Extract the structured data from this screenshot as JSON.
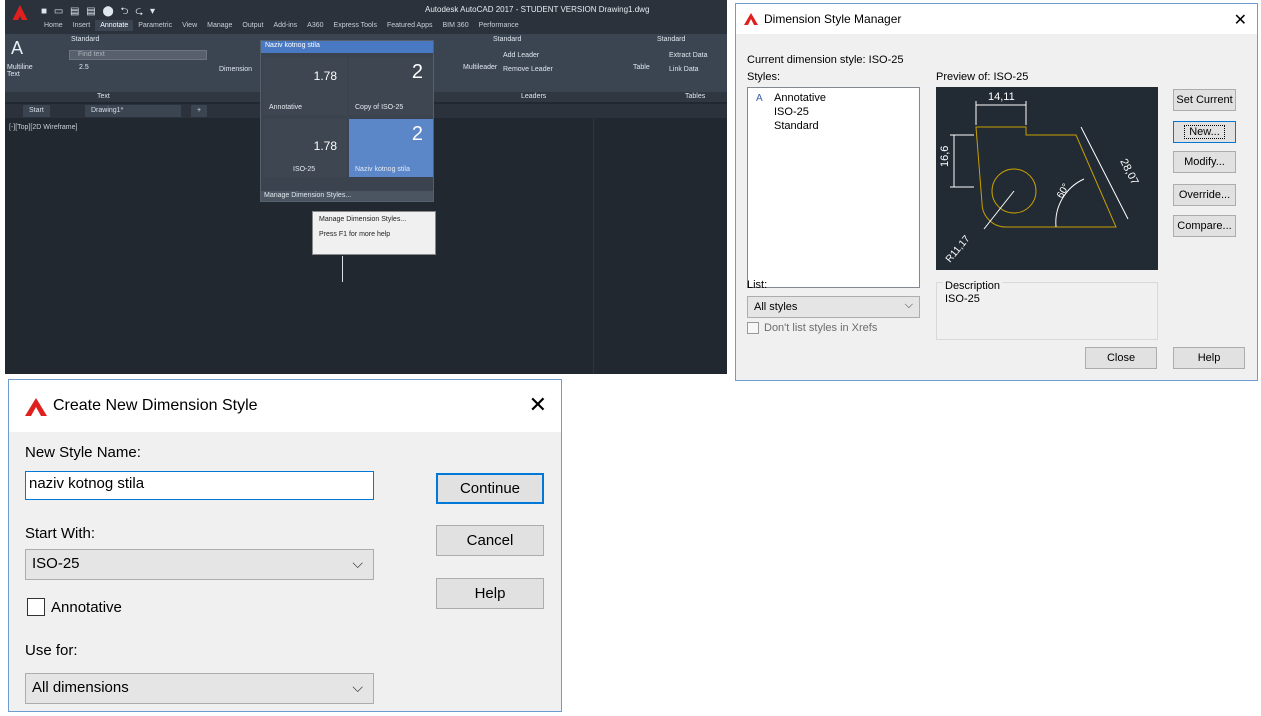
{
  "acad": {
    "title": "Autodesk AutoCAD 2017 - STUDENT VERSION   Drawing1.dwg",
    "ribbon_tabs": [
      "Home",
      "Insert",
      "Annotate",
      "Parametric",
      "View",
      "Manage",
      "Output",
      "Add-ins",
      "A360",
      "Express Tools",
      "Featured Apps",
      "BIM 360",
      "Performance"
    ],
    "active_tab": "Annotate",
    "text_panel": {
      "multiline_text": "Multiline Text",
      "style": "Standard",
      "find": "Find text",
      "height": "2.5",
      "panel_label": "Text"
    },
    "dimension_label": "Dimension",
    "gallery": {
      "header": "Naziv kotnog stila",
      "cells": [
        {
          "value": "1.78",
          "caption": "Annotative",
          "big": "2"
        },
        {
          "caption": "Copy of ISO-25"
        },
        {
          "value": "1.78",
          "caption": "ISO-25",
          "big": "2"
        },
        {
          "caption": "Naziv kotnog stila"
        }
      ],
      "footer": "Manage Dimension Styles..."
    },
    "context_menu": {
      "item1": "Manage Dimension Styles...",
      "item2": "Press F1 for more help"
    },
    "leaders_panel": {
      "multileader": "Multileader",
      "style": "Standard",
      "add_leader": "Add Leader",
      "remove_leader": "Remove Leader",
      "panel_label": "Leaders"
    },
    "tables_panel": {
      "table": "Table",
      "style": "Standard",
      "extract": "Extract Data",
      "link": "Link Data",
      "panel_label": "Tables"
    },
    "doc_tabs": {
      "start": "Start",
      "drawing": "Drawing1*"
    },
    "viewport_label": "[-][Top][2D Wireframe]"
  },
  "dsm": {
    "title": "Dimension Style Manager",
    "current_style": "Current dimension style: ISO-25",
    "styles_label": "Styles:",
    "styles": [
      "Annotative",
      "ISO-25",
      "Standard"
    ],
    "preview_label": "Preview of: ISO-25",
    "preview": {
      "dim1": "14,11",
      "dim2": "16,6",
      "dim3": "28,07",
      "angle": "60°",
      "radius": "R11,17"
    },
    "list_label": "List:",
    "list_value": "All styles",
    "dont_list": "Don't list styles in Xrefs",
    "description_label": "Description",
    "description_value": "ISO-25",
    "buttons": {
      "set_current": "Set Current",
      "new": "New...",
      "modify": "Modify...",
      "override": "Override...",
      "compare": "Compare...",
      "close": "Close",
      "help": "Help"
    }
  },
  "cnds": {
    "title": "Create New Dimension Style",
    "new_style_label": "New Style Name:",
    "new_style_value": "naziv kotnog stila",
    "start_with_label": "Start With:",
    "start_with_value": "ISO-25",
    "annotative_label": "Annotative",
    "use_for_label": "Use for:",
    "use_for_value": "All dimensions",
    "buttons": {
      "continue": "Continue",
      "cancel": "Cancel",
      "help": "Help"
    }
  }
}
